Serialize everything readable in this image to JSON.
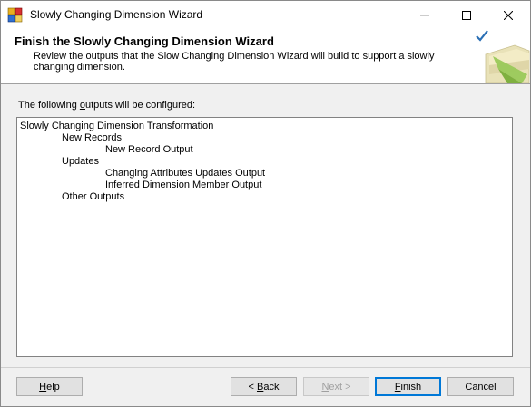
{
  "window": {
    "title": "Slowly Changing Dimension Wizard"
  },
  "header": {
    "title": "Finish the Slowly Changing Dimension Wizard",
    "description": "Review the outputs that the Slow Changing Dimension Wizard will build to support a slowly changing dimension."
  },
  "outputs": {
    "label_pre": "The following ",
    "label_accel": "o",
    "label_post": "utputs will be configured:",
    "tree": [
      {
        "text": "Slowly Changing Dimension Transformation",
        "level": 0
      },
      {
        "text": "New Records",
        "level": 1
      },
      {
        "text": "New Record Output",
        "level": 2
      },
      {
        "text": "Updates",
        "level": 1
      },
      {
        "text": "Changing Attributes Updates Output",
        "level": 2
      },
      {
        "text": "Inferred Dimension Member Output",
        "level": 2
      },
      {
        "text": "Other Outputs",
        "level": 1
      }
    ]
  },
  "buttons": {
    "help": {
      "accel": "H",
      "rest": "elp"
    },
    "back": {
      "pre": "< ",
      "accel": "B",
      "rest": "ack"
    },
    "next": {
      "accel": "N",
      "rest": "ext >"
    },
    "finish": {
      "accel": "F",
      "rest": "inish"
    },
    "cancel": "Cancel"
  },
  "icons": {
    "app": "wizard-app-icon",
    "minimize": "minimize-icon",
    "maximize": "maximize-icon",
    "close": "close-icon",
    "header_graphic": "dimension-checkmark-graphic"
  },
  "colors": {
    "accent": "#0078d7",
    "dialog_bg": "#f0f0f0",
    "checkmark": "#2a6fb5",
    "graphic_green": "#9ac95a"
  }
}
